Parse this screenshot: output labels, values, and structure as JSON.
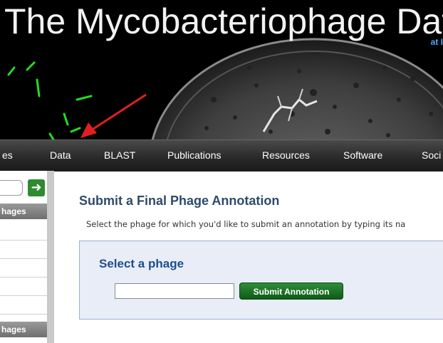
{
  "header": {
    "title": "The Mycobacteriophage Data",
    "subtitle": "at I"
  },
  "nav": {
    "items": [
      {
        "label": "es"
      },
      {
        "label": "Data"
      },
      {
        "label": "BLAST"
      },
      {
        "label": "Publications"
      },
      {
        "label": "Resources"
      },
      {
        "label": "Software"
      },
      {
        "label": "Soci"
      }
    ]
  },
  "sidebar": {
    "search_value": "",
    "go_icon": "arrow-right-icon",
    "section1_label": "hages",
    "section2_label": "hages"
  },
  "main": {
    "title": "Submit a Final Phage Annotation",
    "description": "Select the phage for which you'd like to submit an annotation by typing its na",
    "panel": {
      "heading": "Select a phage",
      "input_value": "",
      "button_label": "Submit Annotation"
    }
  },
  "colors": {
    "banner_bg": "#000000",
    "title_text": "#2e4a6b",
    "panel_heading": "#1f4e8c",
    "button_green": "#1f7a2b",
    "arrow_red": "#e02020"
  }
}
